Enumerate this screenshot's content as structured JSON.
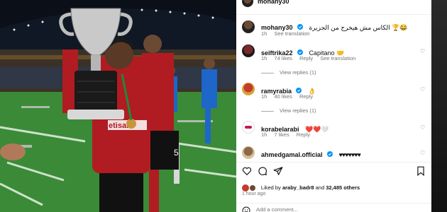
{
  "post": {
    "author": "mohany30"
  },
  "caption": {
    "username": "mohany30",
    "verified": true,
    "text": "الكاس مش هيخرج من الجزيرة 🏆😂",
    "time": "1h",
    "see_translation": "See translation"
  },
  "comments": [
    {
      "username": "seiftrika22",
      "verified": true,
      "text": "Capitano 🤝",
      "time": "1h",
      "likes": "74 likes",
      "reply": "Reply",
      "see_translation": "See translation",
      "view_replies": "View replies (1)"
    },
    {
      "username": "ramyrabia",
      "verified": true,
      "text": "👌",
      "time": "1h",
      "likes": "40 likes",
      "reply": "Reply",
      "view_replies": "View replies (1)"
    },
    {
      "username": "korabelarabi",
      "verified": false,
      "text": "❤️❤️🤍",
      "time": "1h",
      "likes": "7 likes",
      "reply": "Reply"
    },
    {
      "username": "ahmedgamal.official",
      "verified": true,
      "text": "♥♥♥♥♥♥♥"
    }
  ],
  "likes_line": {
    "prefix": "Liked by",
    "user": "araby_badr8",
    "middle": "and",
    "count": "32,485 others"
  },
  "time_ago": "1 hour ago",
  "add_comment_placeholder": "Add a comment...",
  "icons": [
    "heart-icon",
    "comment-icon",
    "share-icon",
    "bookmark-icon",
    "verified-icon",
    "emoji-icon"
  ],
  "colors": {
    "verified": "#0095f6",
    "muted": "#737373",
    "jersey": "#b01c22"
  }
}
